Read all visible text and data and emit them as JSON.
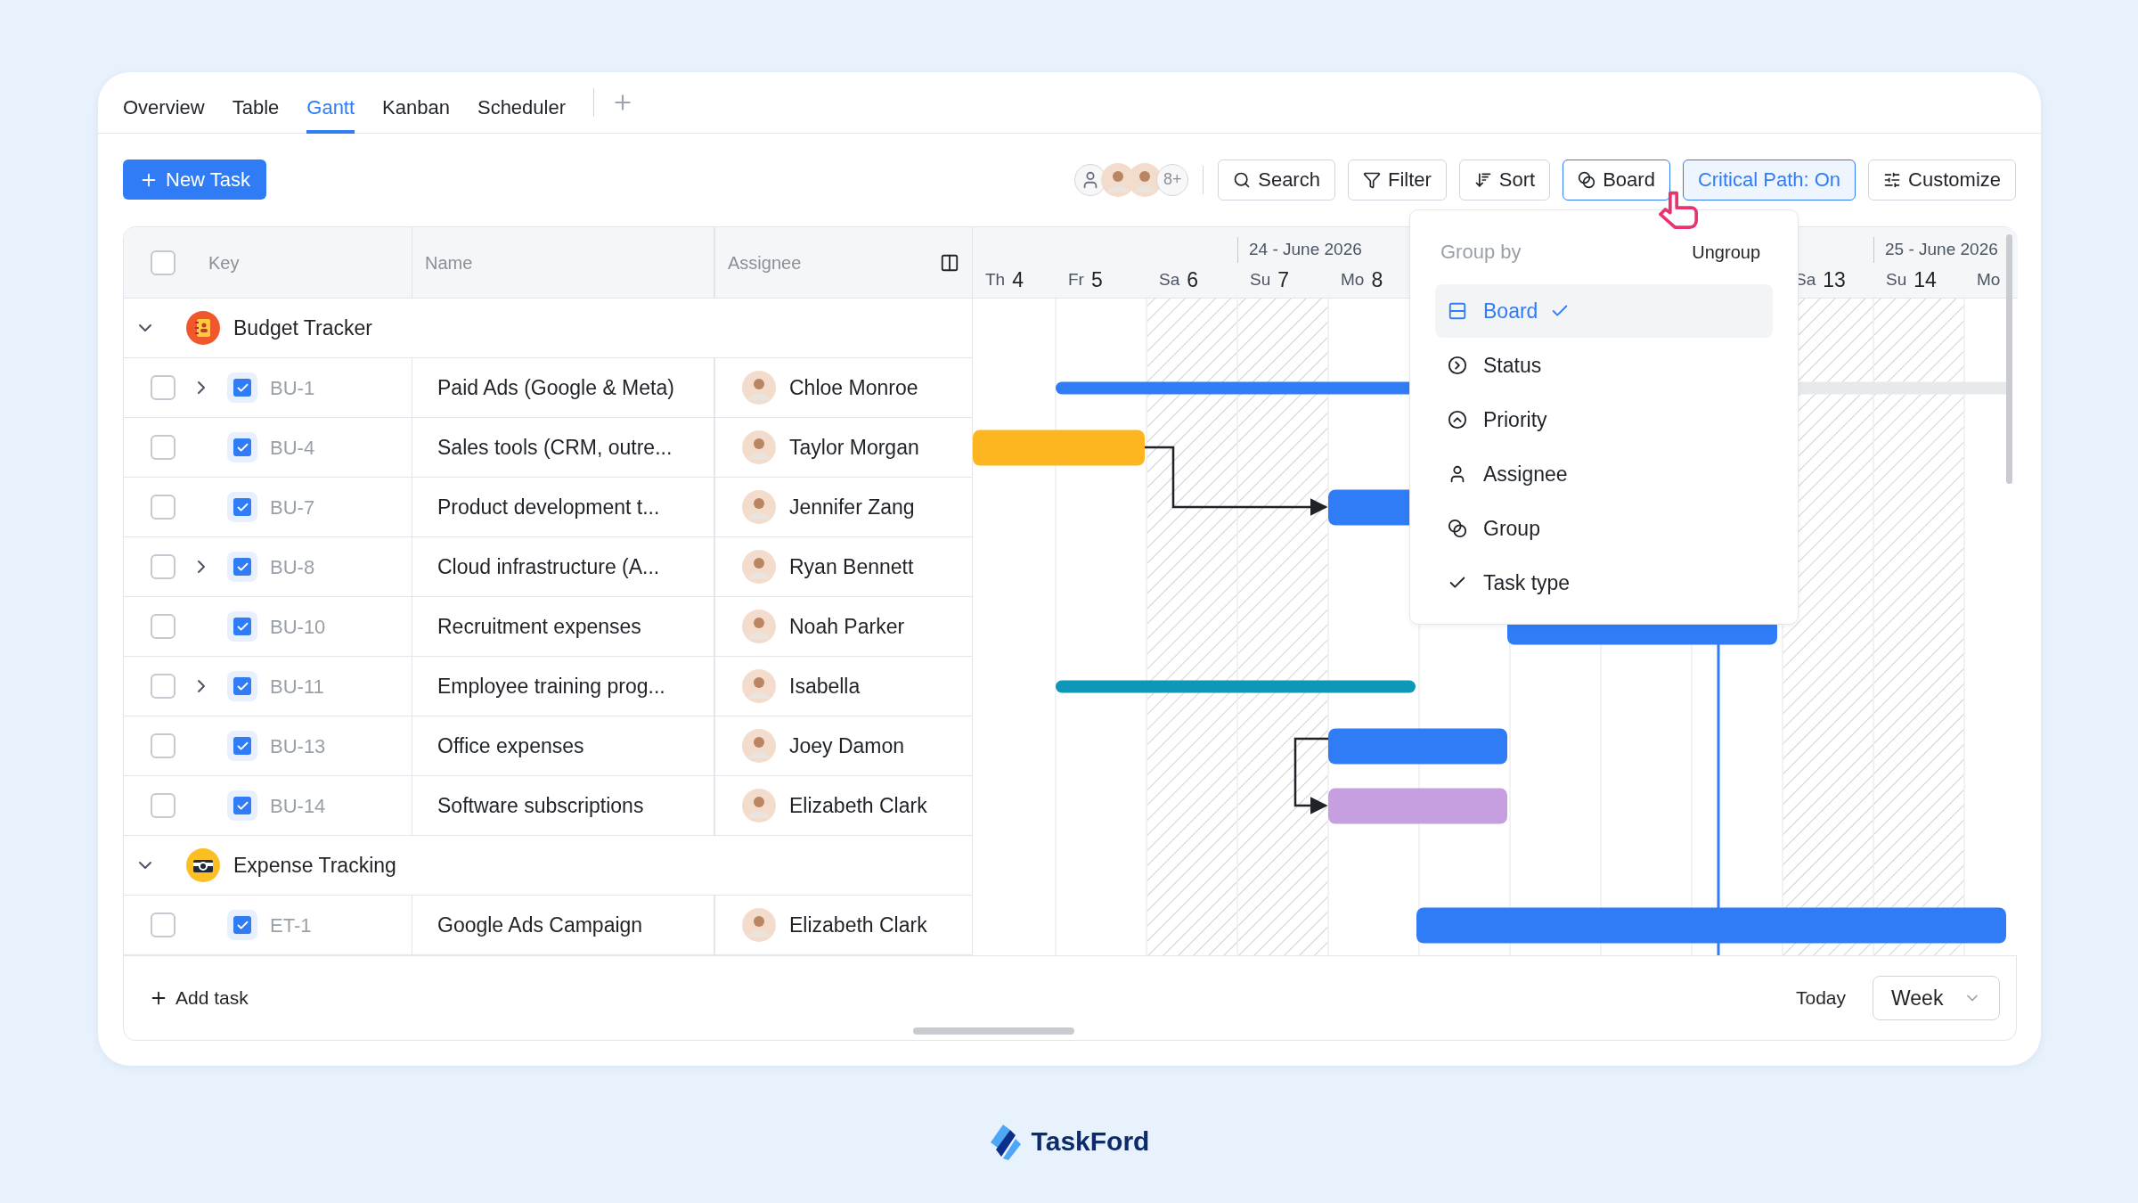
{
  "tabs": [
    {
      "label": "Overview",
      "selected": false
    },
    {
      "label": "Table",
      "selected": false
    },
    {
      "label": "Gantt",
      "selected": true
    },
    {
      "label": "Kanban",
      "selected": false
    },
    {
      "label": "Scheduler",
      "selected": false
    }
  ],
  "toolbar": {
    "new_task": "New Task",
    "avatars_more": "8+",
    "buttons": [
      {
        "label": "Search",
        "kind": "search",
        "selected": false
      },
      {
        "label": "Filter",
        "kind": "filter",
        "selected": false
      },
      {
        "label": "Sort",
        "kind": "sort",
        "selected": false
      },
      {
        "label": "Board",
        "kind": "board",
        "selected": true
      },
      {
        "label": "Critical Path: On",
        "kind": "toggle",
        "selected": true
      },
      {
        "label": "Customize",
        "kind": "customize",
        "selected": false
      }
    ]
  },
  "select_all": {
    "checked": false
  },
  "columns": [
    "Key",
    "Name",
    "Assignee"
  ],
  "timeline": {
    "days": [
      {
        "weekday": "Th",
        "day": "4",
        "weekend": false
      },
      {
        "weekday": "Fr",
        "day": "5",
        "weekend": false
      },
      {
        "weekday": "Sa",
        "day": "6",
        "weekend": true
      },
      {
        "weekday": "Su",
        "day": "7",
        "weekend": true,
        "month": "24 - June 2026"
      },
      {
        "weekday": "Mo",
        "day": "8",
        "weekend": false
      },
      {
        "weekend": false
      },
      {
        "weekend": false
      },
      {
        "weekend": false
      },
      {
        "weekend": false
      },
      {
        "weekday": "Sa",
        "day": "13",
        "weekend": true
      },
      {
        "weekday": "Su",
        "day": "14",
        "weekend": true,
        "month": "25 - June 2026"
      },
      {
        "weekday": "Mo",
        "weekend": false
      }
    ]
  },
  "groups": [
    {
      "title": "Budget Tracker",
      "kind": "notebook",
      "expanded": true,
      "tasks": [
        {
          "key": "BU-1",
          "name": "Paid Ads (Google & Meta)",
          "assignee": "Chloe Monroe",
          "kind": "parent",
          "checked": false,
          "color": "#2f7cf6"
        },
        {
          "key": "BU-4",
          "name": "Sales tools (CRM, outre...",
          "assignee": "Taylor Morgan",
          "kind": "task",
          "checked": false,
          "color": "#fdb61f"
        },
        {
          "key": "BU-7",
          "name": "Product development t...",
          "assignee": "Jennifer Zang",
          "kind": "task",
          "checked": false,
          "color": "#2f7cf6"
        },
        {
          "key": "BU-8",
          "name": "Cloud infrastructure (A...",
          "assignee": "Ryan Bennett",
          "kind": "parent",
          "checked": false
        },
        {
          "key": "BU-10",
          "name": "Recruitment expenses",
          "assignee": "Noah Parker",
          "kind": "task",
          "checked": false,
          "color": "#2f7cf6"
        },
        {
          "key": "BU-11",
          "name": "Employee training prog...",
          "assignee": "Isabella",
          "kind": "parent",
          "checked": false,
          "color": "#0e97b8"
        },
        {
          "key": "BU-13",
          "name": "Office expenses",
          "assignee": "Joey Damon",
          "kind": "task",
          "checked": false,
          "color": "#2f7cf6"
        },
        {
          "key": "BU-14",
          "name": "Software subscriptions",
          "assignee": "Elizabeth Clark",
          "kind": "task",
          "checked": false,
          "color": "#c59fe0"
        }
      ]
    },
    {
      "title": "Expense Tracking",
      "kind": "camera",
      "expanded": true,
      "tasks": [
        {
          "key": "ET-1",
          "name": "Google Ads Campaign",
          "assignee": "Elizabeth Clark",
          "kind": "task",
          "checked": false,
          "color": "#2f7cf6"
        }
      ]
    }
  ],
  "footer": {
    "add_task": "Add task",
    "today": "Today",
    "range": "Week"
  },
  "group_menu": {
    "title": "Group by",
    "ungroup": "Ungroup",
    "items": [
      {
        "label": "Board",
        "kind": "board",
        "selected": true
      },
      {
        "label": "Status",
        "kind": "status",
        "selected": false
      },
      {
        "label": "Priority",
        "kind": "priority",
        "selected": false
      },
      {
        "label": "Assignee",
        "kind": "assignee",
        "selected": false
      },
      {
        "label": "Group",
        "kind": "group",
        "selected": false
      },
      {
        "label": "Task type",
        "kind": "task_type",
        "selected": false
      }
    ]
  },
  "brand": "TaskFord"
}
